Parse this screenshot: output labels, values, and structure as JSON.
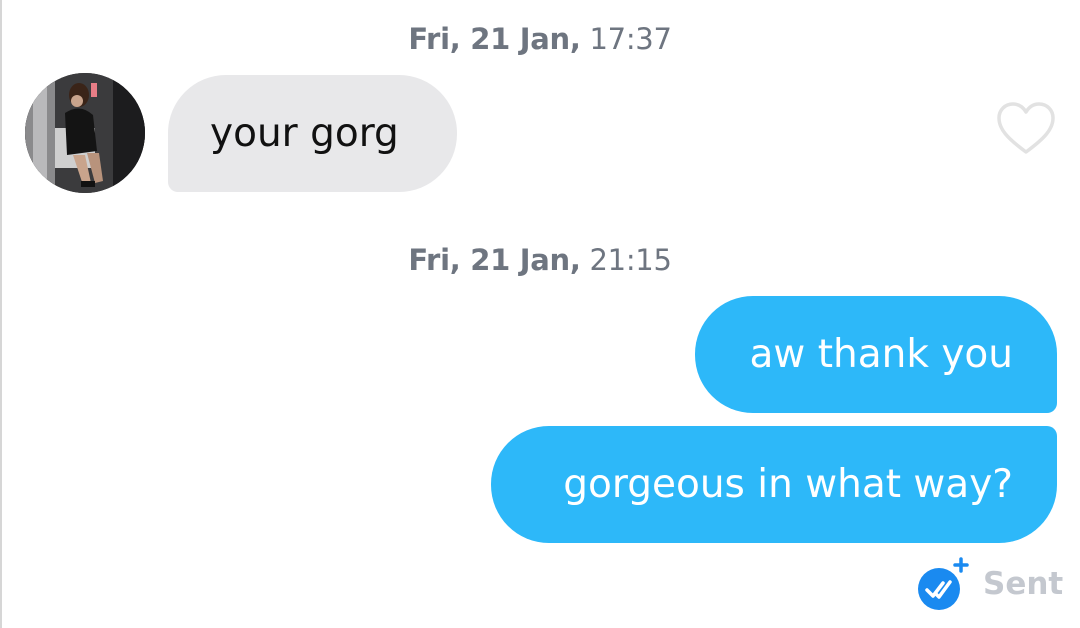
{
  "conversation": {
    "messages": [
      {
        "timestamp_day": "Fri, 21 Jan,",
        "timestamp_time": "17:37",
        "direction": "received",
        "text": "your gorg"
      },
      {
        "timestamp_day": "Fri, 21 Jan,",
        "timestamp_time": "21:15",
        "direction": "sent",
        "text": "aw thank you"
      },
      {
        "direction": "sent",
        "text": "gorgeous in what way?"
      }
    ],
    "status": "Sent",
    "status_icon": "double-check-icon",
    "like_icon": "heart-outline-icon"
  },
  "colors": {
    "sent_bubble": "#2db8f9",
    "received_bubble": "#e8e8ea",
    "status_text": "#c4c8cf",
    "read_receipt": "#1a8af0"
  }
}
